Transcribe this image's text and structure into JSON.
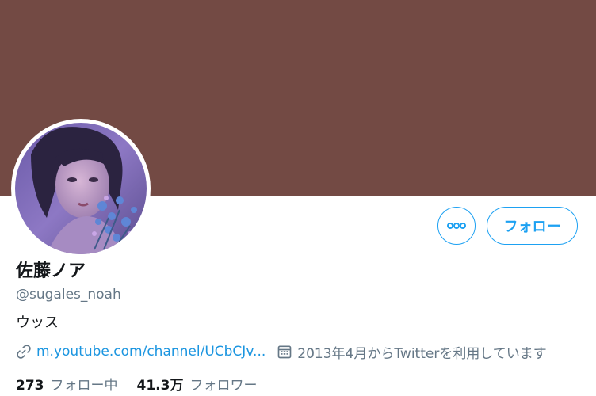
{
  "profile": {
    "display_name": "佐藤ノア",
    "handle": "@sugales_noah",
    "bio": "ウッス",
    "url_text": "m.youtube.com/channel/UCbCJv...",
    "joined_text": "2013年4月からTwitterを利用しています"
  },
  "actions": {
    "more_icon": "more-dots-icon",
    "follow_label": "フォロー"
  },
  "stats": {
    "following_count": "273",
    "following_label": "フォロー中",
    "followers_count": "41.3万",
    "followers_label": "フォロワー"
  },
  "colors": {
    "banner": "#734a44",
    "accent": "#1da1f2",
    "link": "#1b95e0",
    "muted": "#657786",
    "text": "#14171a"
  }
}
